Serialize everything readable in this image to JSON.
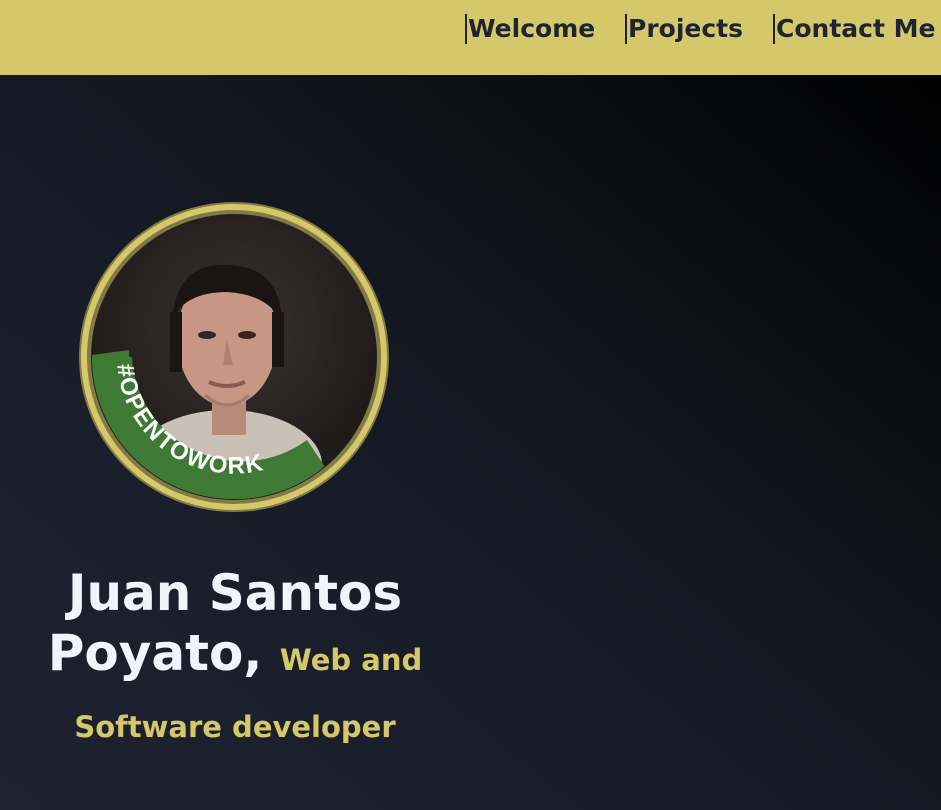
{
  "nav": {
    "items": [
      {
        "label": "Welcome"
      },
      {
        "label": "Projects"
      },
      {
        "label": "Contact Me"
      }
    ]
  },
  "profile": {
    "badge_text": "#OPENTOWORK",
    "name": "Juan Santos Poyato,",
    "tagline": "Web and Software developer"
  },
  "colors": {
    "accent": "#d4c86a",
    "badge_green": "#3f7a35",
    "text_light": "#eef6fb",
    "nav_text": "#1f2430"
  }
}
